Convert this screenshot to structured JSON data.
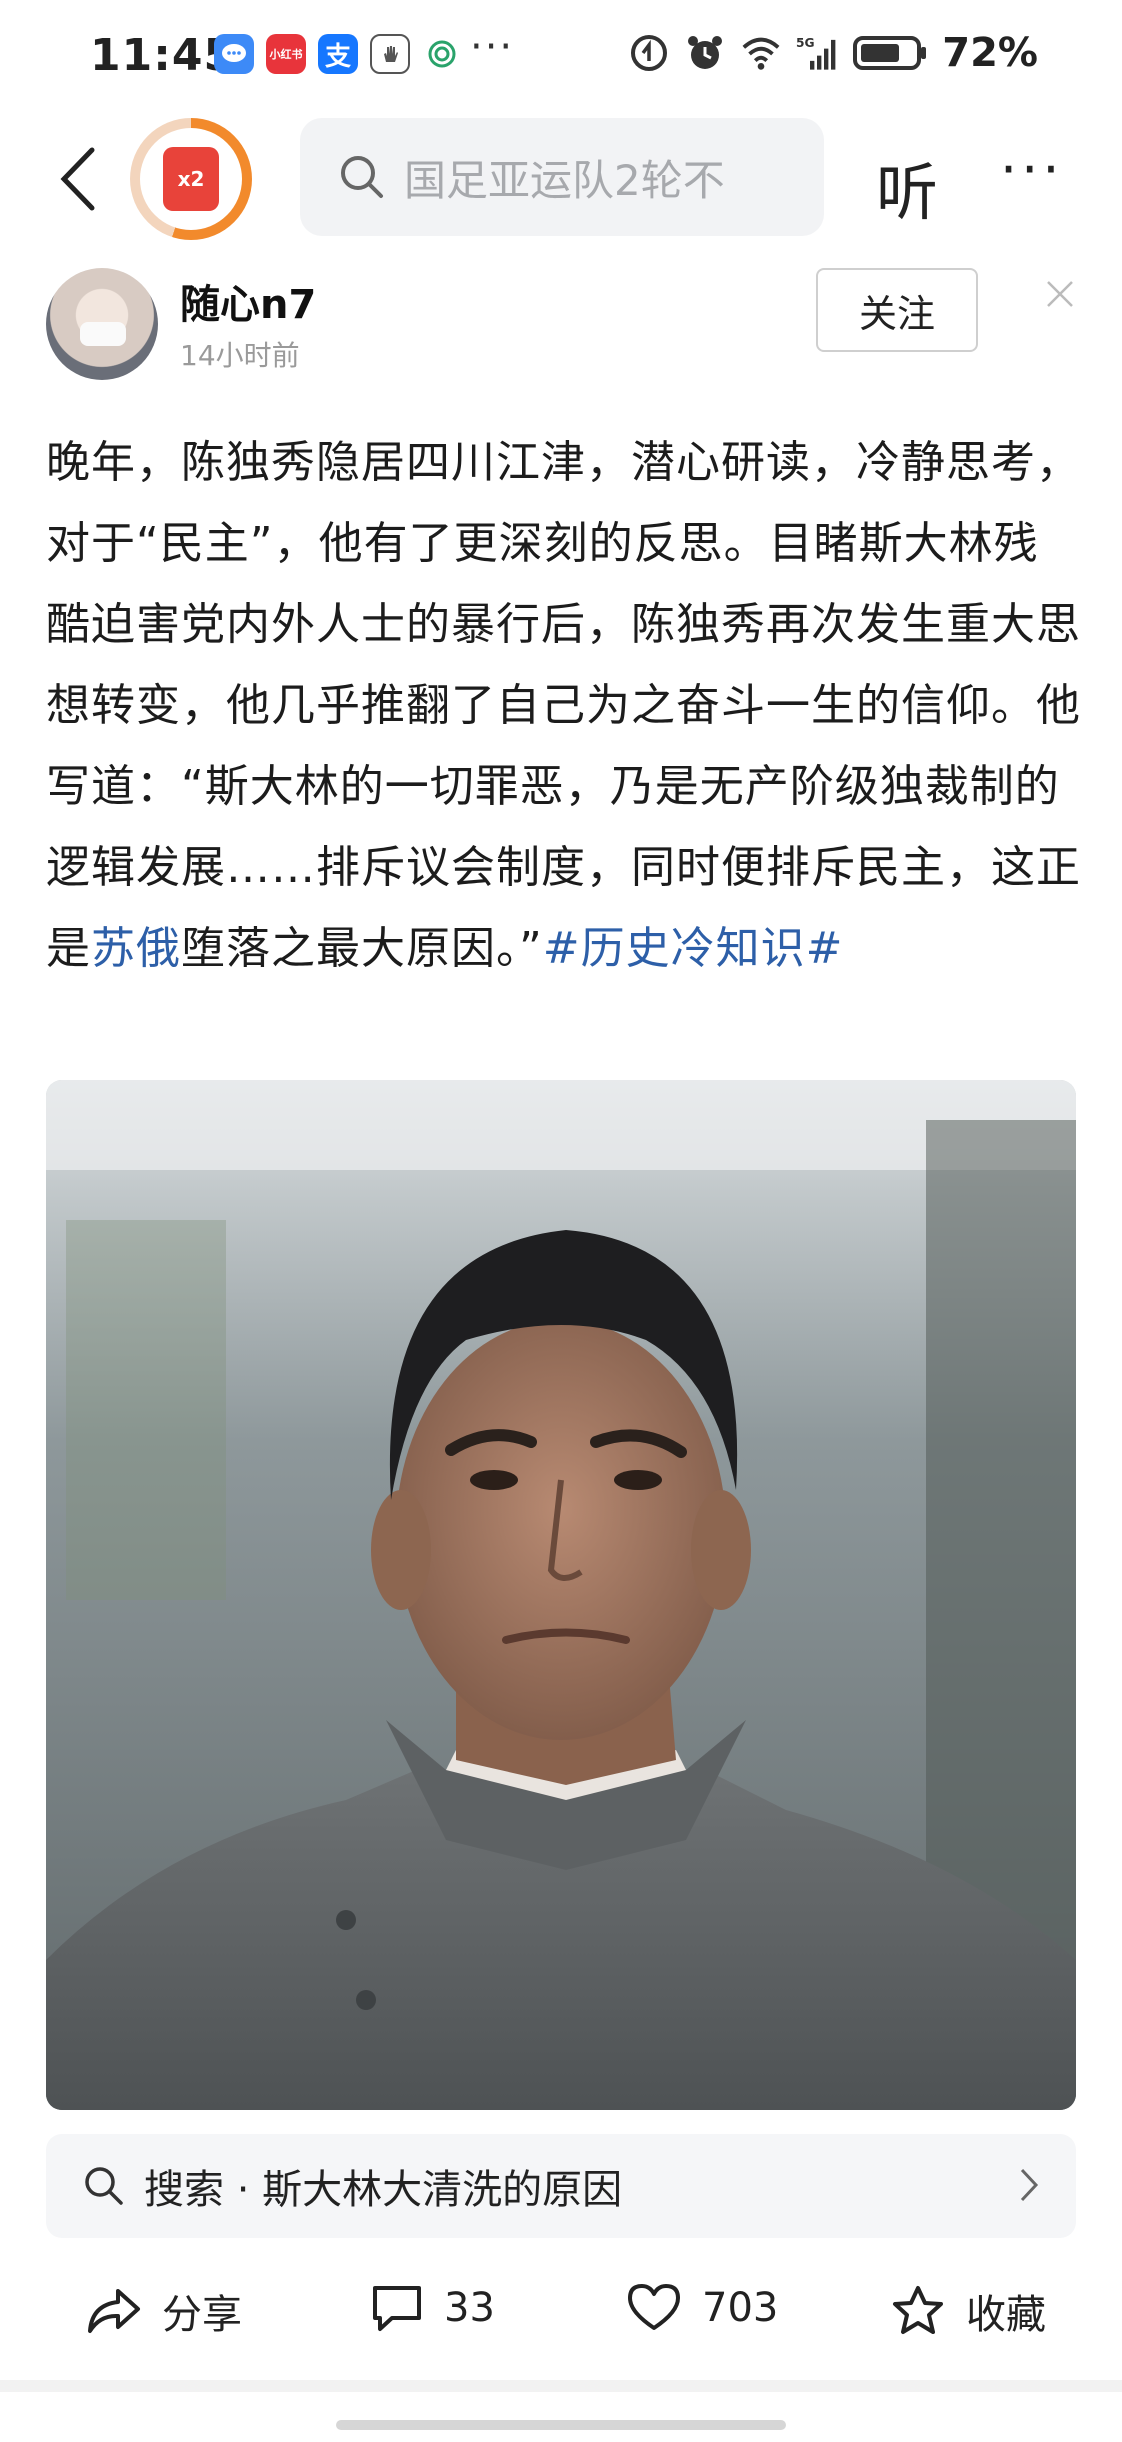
{
  "status_bar": {
    "time": "11:45",
    "app_badges": [
      {
        "name": "message-app-icon",
        "text": "",
        "color": "#3d8af7"
      },
      {
        "name": "xiaohongshu-app-icon",
        "text": "小红书",
        "color": "#e8343b"
      },
      {
        "name": "alipay-app-icon",
        "text": "支",
        "color": "#1677ff"
      },
      {
        "name": "hand-app-icon",
        "text": "",
        "color": "#555555"
      },
      {
        "name": "mobile-app-icon",
        "text": "",
        "color": "#2aa36b"
      }
    ],
    "more_dots": "···",
    "battery": "72%"
  },
  "nav": {
    "reward_badge": "x2",
    "search_placeholder": "国足亚运队2轮不",
    "listen_label": "听",
    "more_label": "···"
  },
  "author": {
    "name": "随心n7",
    "time": "14小时前",
    "follow_label": "关注"
  },
  "article": {
    "text_before_link": "晚年，陈独秀隐居四川江津，潜心研读，冷静思考，对于“民主”，他有了更深刻的反思。目睹斯大林残酷迫害党内外人士的暴行后，陈独秀再次发生重大思想转变，他几乎推翻了自己为之奋斗一生的信仰。他写道：“斯大林的一切罪恶，乃是无产阶级独裁制的逻辑发展……排斥议会制度，同时便排斥民主，这正是",
    "link_text": "苏俄",
    "text_after_link": "堕落之最大原因。”",
    "hashtag": "#历史冷知识#"
  },
  "suggestion": {
    "label": "搜索 · 斯大林大清洗的原因"
  },
  "actions": {
    "share_label": "分享",
    "comment_count": "33",
    "like_count": "703",
    "favorite_label": "收藏"
  },
  "colors": {
    "link": "#2d5fa8",
    "reward_ring": "#f28a2c",
    "reward_envelope": "#e8433a"
  }
}
